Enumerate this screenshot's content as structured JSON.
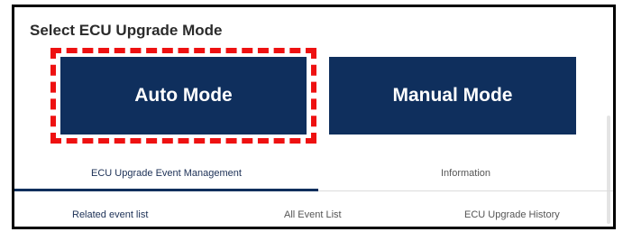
{
  "header": {
    "title": "Select ECU Upgrade Mode"
  },
  "modes": {
    "auto_label": "Auto Mode",
    "manual_label": "Manual Mode",
    "button_color": "#0f2f5d",
    "highlight_color": "#ee1111"
  },
  "tabs": [
    {
      "label": "ECU Upgrade Event Management",
      "selected": true
    },
    {
      "label": "Information",
      "selected": false
    }
  ],
  "subtabs": [
    {
      "label": "Related event list",
      "selected": true
    },
    {
      "label": "All Event List",
      "selected": false
    },
    {
      "label": "ECU Upgrade History",
      "selected": false
    }
  ]
}
